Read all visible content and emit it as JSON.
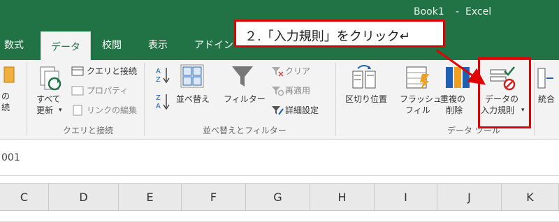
{
  "window": {
    "book_name": "Book1",
    "separator": "-",
    "app_name": "Excel"
  },
  "tabs": [
    {
      "label": "数式"
    },
    {
      "label": "データ",
      "active": true
    },
    {
      "label": "校閲"
    },
    {
      "label": "表示"
    },
    {
      "label": "アドイン"
    }
  ],
  "ribbon": {
    "partial_left": {
      "line1": "の",
      "line2": "続"
    },
    "refresh_all": {
      "line1": "すべて",
      "line2": "更新"
    },
    "queries_group": {
      "queries_connections": "クエリと接続",
      "properties": "プロパティ",
      "edit_links": "リンクの編集",
      "group_label": "クエリと接続"
    },
    "sort_filter_group": {
      "sort": "並べ替え",
      "filter": "フィルター",
      "clear": "クリア",
      "reapply": "再適用",
      "advanced": "詳細設定",
      "group_label": "並べ替えとフィルター"
    },
    "data_tools_group": {
      "text_to_columns": "区切り位置",
      "flash_fill": {
        "line1": "フラッシュ",
        "line2": "フィル"
      },
      "remove_duplicates": {
        "line1": "重複の",
        "line2": "削除"
      },
      "data_validation": {
        "line1": "データの",
        "line2": "入力規則"
      },
      "group_label": "データ ツール"
    },
    "consolidate": "統合"
  },
  "formula_bar": {
    "name_box_value": "001"
  },
  "columns": [
    "C",
    "D",
    "E",
    "F",
    "G",
    "H",
    "I",
    "J",
    "K"
  ],
  "annotation": {
    "text": "２.「入力規則」をクリック↵"
  },
  "colors": {
    "excel_green": "#217346",
    "highlight_red": "#e00000",
    "ribbon_bg": "#f3f3f3"
  }
}
